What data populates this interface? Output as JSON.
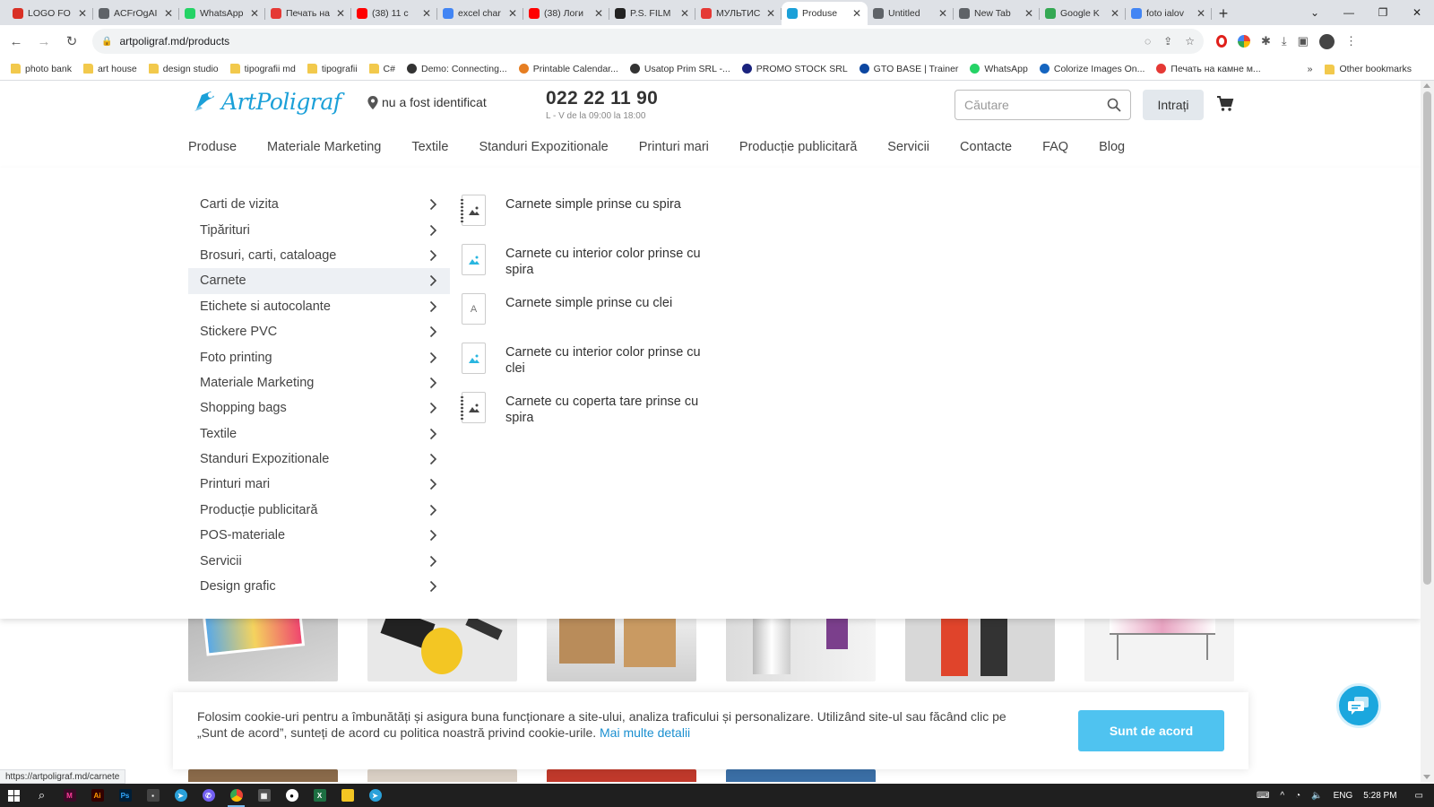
{
  "browser": {
    "tabs": [
      {
        "label": "LOGO FO",
        "icon": "gmail-icon",
        "color": "#d93025"
      },
      {
        "label": "ACFrOgAI",
        "icon": "globe-icon",
        "color": "#5f6368"
      },
      {
        "label": "WhatsApp",
        "icon": "whatsapp-icon",
        "color": "#25d366"
      },
      {
        "label": "Печать на",
        "icon": "site-icon",
        "color": "#e53935"
      },
      {
        "label": "(38) 11 c",
        "icon": "youtube-icon",
        "color": "#ff0000"
      },
      {
        "label": "excel char",
        "icon": "google-icon",
        "color": "#4285f4"
      },
      {
        "label": "(38) Логи",
        "icon": "youtube-icon",
        "color": "#ff0000"
      },
      {
        "label": "P.S. FILM",
        "icon": "site-icon",
        "color": "#222222"
      },
      {
        "label": "МУЛЬТИС",
        "icon": "site-icon",
        "color": "#e53935"
      },
      {
        "label": "Produse",
        "icon": "artpoligraf-icon",
        "color": "#1ba0d8",
        "active": true
      },
      {
        "label": "Untitled",
        "icon": "globe-icon",
        "color": "#5f6368"
      },
      {
        "label": "New Tab",
        "icon": "chrome-icon",
        "color": "#5f6368"
      },
      {
        "label": "Google K",
        "icon": "maps-icon",
        "color": "#34a853"
      },
      {
        "label": "foto ialov",
        "icon": "google-icon",
        "color": "#4285f4"
      }
    ],
    "url": "artpoligraf.md/products",
    "bookmarks": [
      {
        "label": "photo bank",
        "type": "folder"
      },
      {
        "label": "art house",
        "type": "folder"
      },
      {
        "label": "design studio",
        "type": "folder"
      },
      {
        "label": "tipografii md",
        "type": "folder"
      },
      {
        "label": "tipografii",
        "type": "folder"
      },
      {
        "label": "C#",
        "type": "folder"
      },
      {
        "label": "Demo: Connecting...",
        "type": "site",
        "color": "#333333"
      },
      {
        "label": "Printable Calendar...",
        "type": "site",
        "color": "#e67e22"
      },
      {
        "label": "Usatop Prim SRL -...",
        "type": "site",
        "color": "#333333"
      },
      {
        "label": "PROMO STOCK SRL",
        "type": "site",
        "color": "#1a237e"
      },
      {
        "label": "GTO BASE | Trainer",
        "type": "site",
        "color": "#0d47a1"
      },
      {
        "label": "WhatsApp",
        "type": "site",
        "color": "#25d366"
      },
      {
        "label": "Colorize Images On...",
        "type": "site",
        "color": "#1565c0"
      },
      {
        "label": "Печать на камне м...",
        "type": "site",
        "color": "#e53935"
      }
    ],
    "other_bookmarks": "Other bookmarks",
    "status_url": "https://artpoligraf.md/carnete"
  },
  "header": {
    "logo_text": "ArtPoligraf",
    "location": "nu a fost identificat",
    "phone": "022 22 11 90",
    "hours": "L - V de la 09:00 la 18:00",
    "search_placeholder": "Căutare",
    "login_label": "Intrați"
  },
  "nav": [
    "Produse",
    "Materiale Marketing",
    "Textile",
    "Standuri Expozitionale",
    "Printuri mari",
    "Producție publicitară",
    "Servicii",
    "Contacte",
    "FAQ",
    "Blog"
  ],
  "menu": {
    "categories": [
      {
        "label": "Carti de vizita"
      },
      {
        "label": "Tipărituri"
      },
      {
        "label": "Brosuri, carti, cataloage"
      },
      {
        "label": "Carnete",
        "active": true
      },
      {
        "label": "Etichete si autocolante"
      },
      {
        "label": "Stickere PVC"
      },
      {
        "label": "Foto printing"
      },
      {
        "label": "Materiale Marketing"
      },
      {
        "label": "Shopping bags"
      },
      {
        "label": "Textile"
      },
      {
        "label": "Standuri Expozitionale"
      },
      {
        "label": "Printuri mari"
      },
      {
        "label": "Producție publicitară"
      },
      {
        "label": "POS-materiale"
      },
      {
        "label": "Servicii"
      },
      {
        "label": "Design grafic"
      }
    ],
    "subcategories": [
      {
        "label": "Carnete simple prinse cu spira",
        "thumb": "spiral-image"
      },
      {
        "label": "Carnete cu interior color prinse cu spira",
        "thumb": "color-image"
      },
      {
        "label": "Carnete simple prinse cu clei",
        "thumb": "letter",
        "letter": "A"
      },
      {
        "label": "Carnete cu interior color prinse cu clei",
        "thumb": "color-image"
      },
      {
        "label": "Carnete cu coperta tare prinse cu spira",
        "thumb": "spiral-image"
      }
    ]
  },
  "cookie": {
    "text": "Folosim cookie-uri pentru a îmbunătăți și asigura buna funcționare a site-ului, analiza traficului și personalizare. Utilizând site-ul sau făcând clic pe „Sunt de acord”, sunteți de acord cu politica noastră privind cookie-urile.",
    "link": "Mai multe detalii",
    "accept": "Sunt de acord"
  },
  "taskbar": {
    "lang": "ENG",
    "time": "5:28 PM"
  },
  "colors": {
    "brand": "#1ba0d8",
    "accept": "#4fc3f0",
    "active_row": "#edf0f4"
  }
}
